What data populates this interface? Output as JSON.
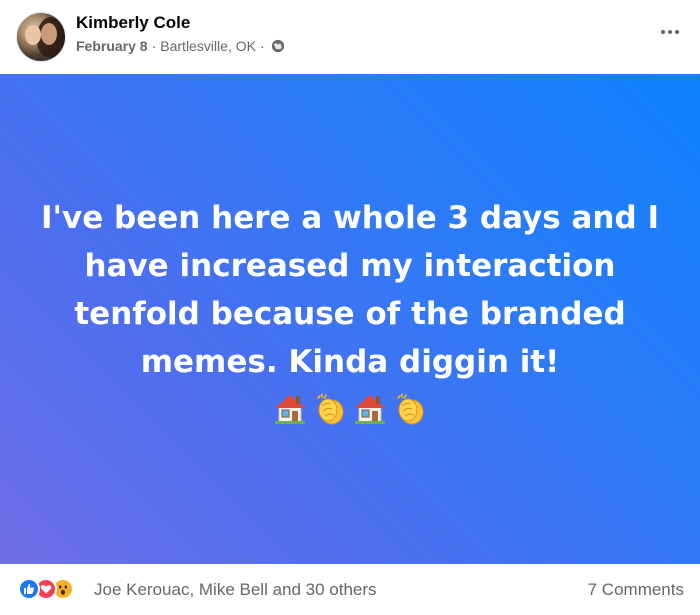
{
  "post": {
    "author": "Kimberly Cole",
    "date": "February 8",
    "location": "Bartlesville, OK",
    "text": "I've been here a whole 3 days and I have increased my interaction tenfold because of the branded memes. Kinda diggin it!",
    "emojis": [
      "house-emoji",
      "clapping-hands-emoji",
      "house-emoji",
      "clapping-hands-emoji"
    ],
    "background_gradient": [
      "#6f6fe6",
      "#0f82fb"
    ]
  },
  "footer": {
    "reactions": [
      "like",
      "love",
      "wow"
    ],
    "reaction_names": "Joe Kerouac, Mike Bell and 30 others",
    "comments": "7 Comments"
  }
}
